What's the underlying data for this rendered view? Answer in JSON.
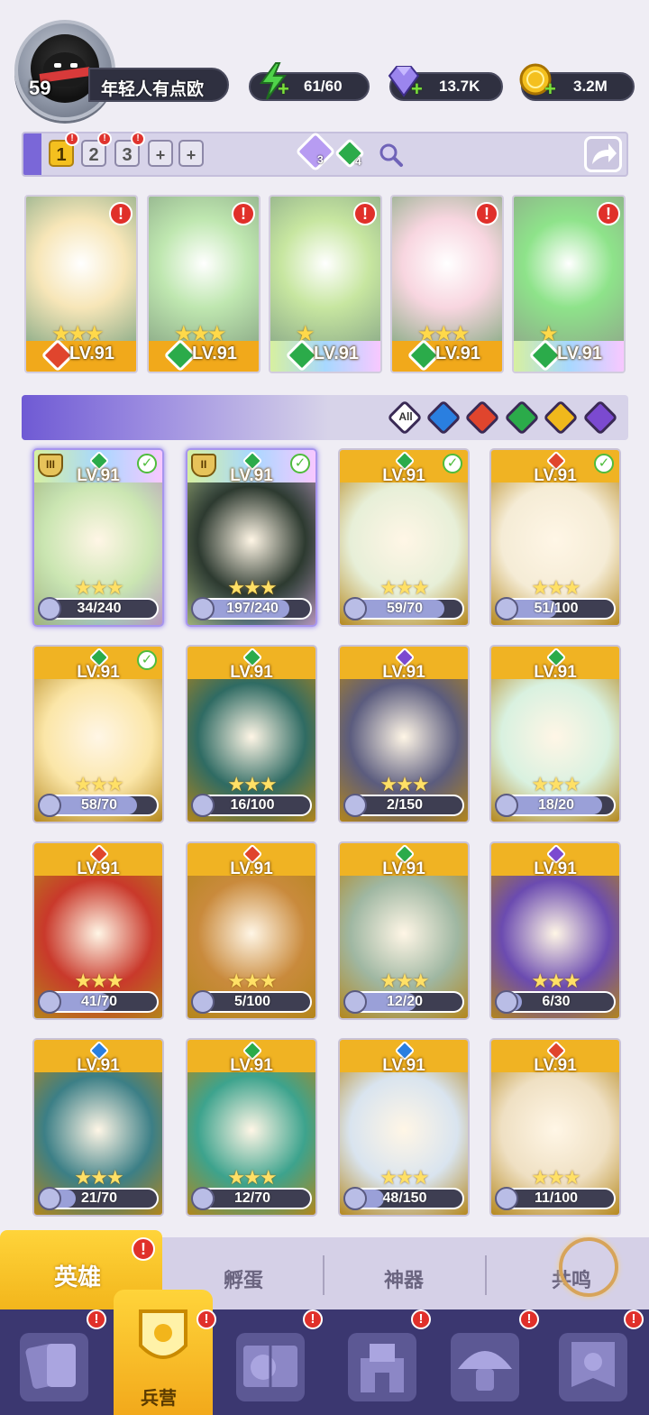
{
  "player": {
    "level": "59",
    "name": "年轻人有点欧"
  },
  "resources": [
    {
      "name": "energy",
      "value": "61/60",
      "icon": "lightning-icon",
      "color": "#4fd34a"
    },
    {
      "name": "gems",
      "value": "13.7K",
      "icon": "diamond-icon",
      "color": "#8f7be8"
    },
    {
      "name": "gold",
      "value": "3.2M",
      "icon": "coin-icon",
      "color": "#f4c01f"
    }
  ],
  "team_slots": [
    "1",
    "2",
    "3",
    "+",
    "+"
  ],
  "team_counters": {
    "purple": "3",
    "green": "4"
  },
  "team": [
    {
      "level": "LV.91",
      "element": "fire",
      "stars": "★★★",
      "color": "#f7e6b8"
    },
    {
      "level": "LV.91",
      "element": "nature",
      "stars": "★★★",
      "color": "#bfe7b0"
    },
    {
      "level": "LV.91",
      "element": "nature",
      "stars": "★",
      "color": "#c7e6a0"
    },
    {
      "level": "LV.91",
      "element": "nature",
      "stars": "★★★",
      "color": "#f8d6e0"
    },
    {
      "level": "LV.91",
      "element": "nature",
      "stars": "★",
      "color": "#8ee38a"
    }
  ],
  "filters": {
    "all_label": "All",
    "elements": [
      "water",
      "fire",
      "nature",
      "light",
      "dark"
    ]
  },
  "heroes": [
    {
      "level": "LV.91",
      "element": "nature",
      "progress": "34/240",
      "fraction": 0.14,
      "checked": true,
      "tier": "III",
      "bg": "#cbe6b2"
    },
    {
      "level": "LV.91",
      "element": "nature",
      "progress": "197/240",
      "fraction": 0.82,
      "checked": true,
      "tier": "II",
      "bg": "#2d3a30"
    },
    {
      "level": "LV.91",
      "element": "nature",
      "progress": "59/70",
      "fraction": 0.84,
      "checked": true,
      "tier": "",
      "bg": "#e7efd8"
    },
    {
      "level": "LV.91",
      "element": "fire",
      "progress": "51/100",
      "fraction": 0.51,
      "checked": true,
      "tier": "",
      "bg": "#f5ecd6"
    },
    {
      "level": "LV.91",
      "element": "nature",
      "progress": "58/70",
      "fraction": 0.83,
      "checked": true,
      "tier": "",
      "bg": "#fbe6a8"
    },
    {
      "level": "LV.91",
      "element": "nature",
      "progress": "16/100",
      "fraction": 0.16,
      "checked": false,
      "tier": "",
      "bg": "#2f6b63"
    },
    {
      "level": "LV.91",
      "element": "dark",
      "progress": "2/150",
      "fraction": 0.02,
      "checked": false,
      "tier": "",
      "bg": "#5b5c7e"
    },
    {
      "level": "LV.91",
      "element": "nature",
      "progress": "18/20",
      "fraction": 0.9,
      "checked": false,
      "tier": "",
      "bg": "#d9f1e0"
    },
    {
      "level": "LV.91",
      "element": "fire",
      "progress": "41/70",
      "fraction": 0.59,
      "checked": false,
      "tier": "",
      "bg": "#c9392b"
    },
    {
      "level": "LV.91",
      "element": "fire",
      "progress": "5/100",
      "fraction": 0.05,
      "checked": false,
      "tier": "",
      "bg": "#c98a3c"
    },
    {
      "level": "LV.91",
      "element": "nature",
      "progress": "12/20",
      "fraction": 0.6,
      "checked": false,
      "tier": "",
      "bg": "#9fb7a2"
    },
    {
      "level": "LV.91",
      "element": "dark",
      "progress": "6/30",
      "fraction": 0.2,
      "checked": false,
      "tier": "",
      "bg": "#6b4bb0"
    },
    {
      "level": "LV.91",
      "element": "water",
      "progress": "21/70",
      "fraction": 0.3,
      "checked": false,
      "tier": "",
      "bg": "#3c7f86"
    },
    {
      "level": "LV.91",
      "element": "nature",
      "progress": "12/70",
      "fraction": 0.17,
      "checked": false,
      "tier": "",
      "bg": "#3da38d"
    },
    {
      "level": "LV.91",
      "element": "water",
      "progress": "48/150",
      "fraction": 0.32,
      "checked": false,
      "tier": "",
      "bg": "#d9e4ef"
    },
    {
      "level": "LV.91",
      "element": "fire",
      "progress": "11/100",
      "fraction": 0.11,
      "checked": false,
      "tier": "",
      "bg": "#efe0c3"
    }
  ],
  "tabs": [
    "英雄",
    "孵蛋",
    "神器",
    "共鸣"
  ],
  "nav": {
    "active_label": "兵营",
    "items": [
      "cards-icon",
      "barracks-icon",
      "book-icon",
      "castle-icon",
      "mushroom-icon",
      "banner-icon"
    ]
  },
  "colors": {
    "fire": "#e0452d",
    "nature": "#2bab4a",
    "water": "#2a7fe0",
    "dark": "#7b4ad0",
    "light": "#f0b81c"
  }
}
